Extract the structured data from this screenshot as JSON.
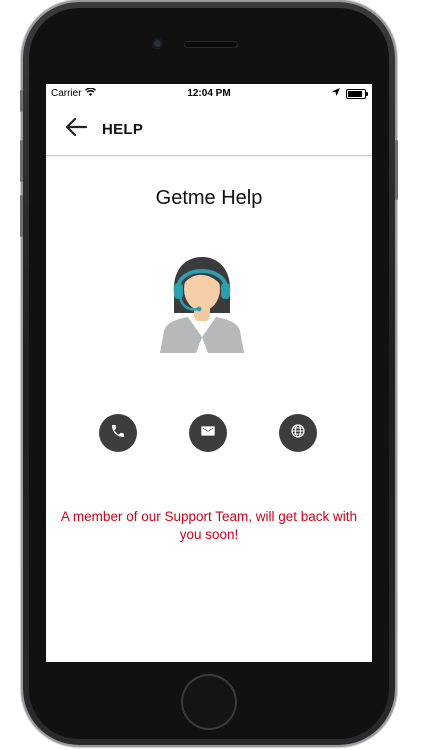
{
  "status_bar": {
    "carrier": "Carrier",
    "time": "12:04 PM",
    "icons": [
      "wifi-icon",
      "location-arrow-icon",
      "battery-icon"
    ]
  },
  "app_bar": {
    "back_icon": "arrow-left-icon",
    "title": "HELP"
  },
  "main": {
    "heading": "Getme Help",
    "illustration": "support-agent-headset",
    "contact_buttons": [
      {
        "icon": "phone-icon"
      },
      {
        "icon": "mail-icon"
      },
      {
        "icon": "globe-icon"
      }
    ],
    "message": "A member of our Support Team, will get back with you soon!"
  },
  "colors": {
    "message_text": "#d0021b",
    "contact_button_bg": "#3d3d3d",
    "headset": "#2a9fb0",
    "jacket": "#b7b8ba"
  }
}
